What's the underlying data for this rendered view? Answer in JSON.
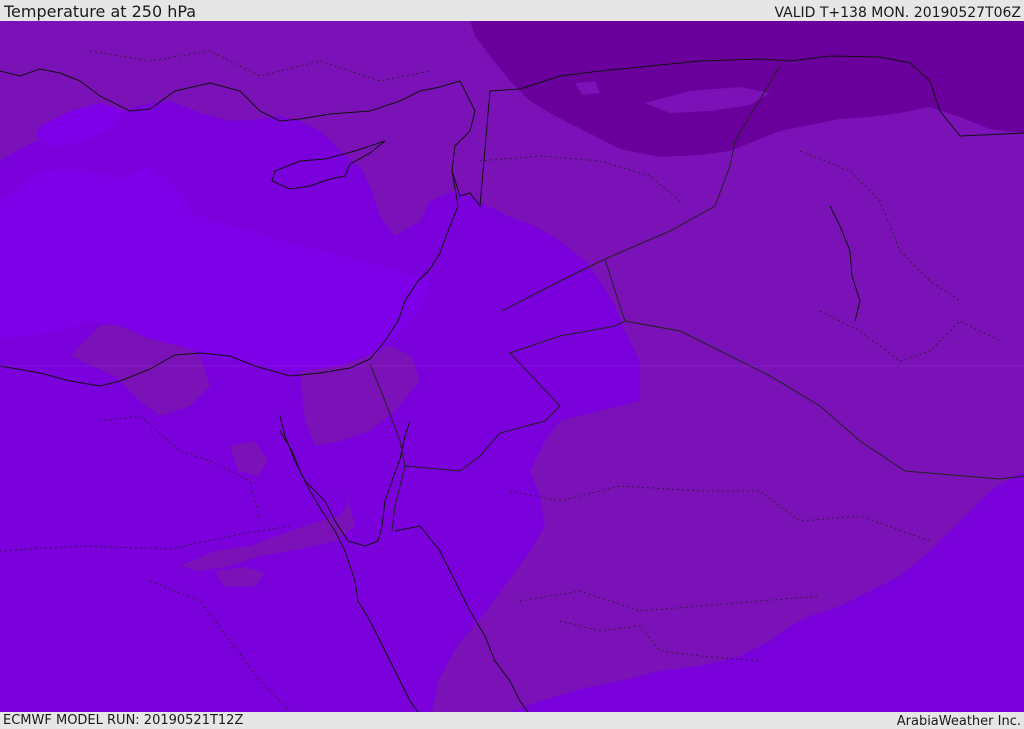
{
  "header": {
    "title": "Temperature at 250 hPa",
    "valid": "VALID T+138 MON. 20190527T06Z"
  },
  "footer": {
    "model_run": "ECMWF MODEL RUN: 20190521T12Z",
    "credit": "ArabiaWeather Inc."
  },
  "colors": {
    "warm_band": "#7a00dc",
    "mid_band": "#7b12b8",
    "cold_band": "#6a009c",
    "sea_pocket": "#7d00e8",
    "coastline": "#111111",
    "border": "#222222"
  }
}
